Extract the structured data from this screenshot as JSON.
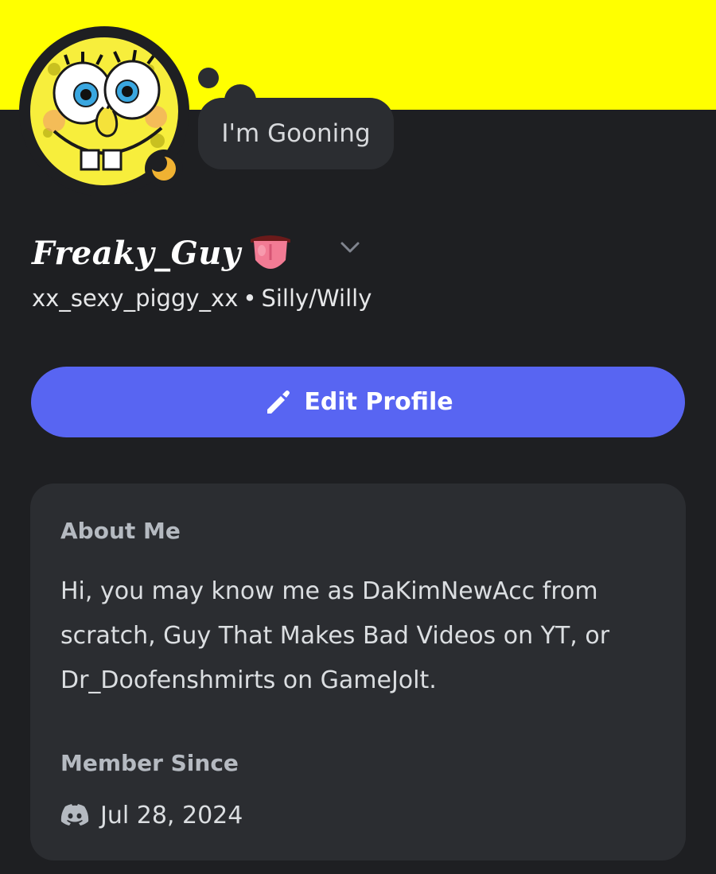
{
  "banner": {
    "color": "#ffff00"
  },
  "avatar": {
    "icon": "spongebob-face-avatar"
  },
  "status": {
    "icon": "moon-idle-icon",
    "color": "#f0b232",
    "text": "I'm Gooning"
  },
  "profile": {
    "display_name": "Freaky_Guy",
    "display_name_emoji": "👅",
    "username": "xx_sexy_piggy_xx",
    "separator": "•",
    "pronouns": "Silly/Willy"
  },
  "actions": {
    "edit_profile_label": "Edit Profile",
    "edit_icon": "pencil-icon"
  },
  "about": {
    "title": "About Me",
    "body": "Hi, you may know me as DaKimNewAcc from scratch, Guy That Makes Bad Videos on YT, or Dr_Doofenshmirts on GameJolt."
  },
  "member_since": {
    "title": "Member Since",
    "icon": "discord-logo-icon",
    "date": "Jul 28, 2024"
  },
  "colors": {
    "background": "#1e1f22",
    "card": "#2b2d31",
    "accent": "#5865f2"
  }
}
